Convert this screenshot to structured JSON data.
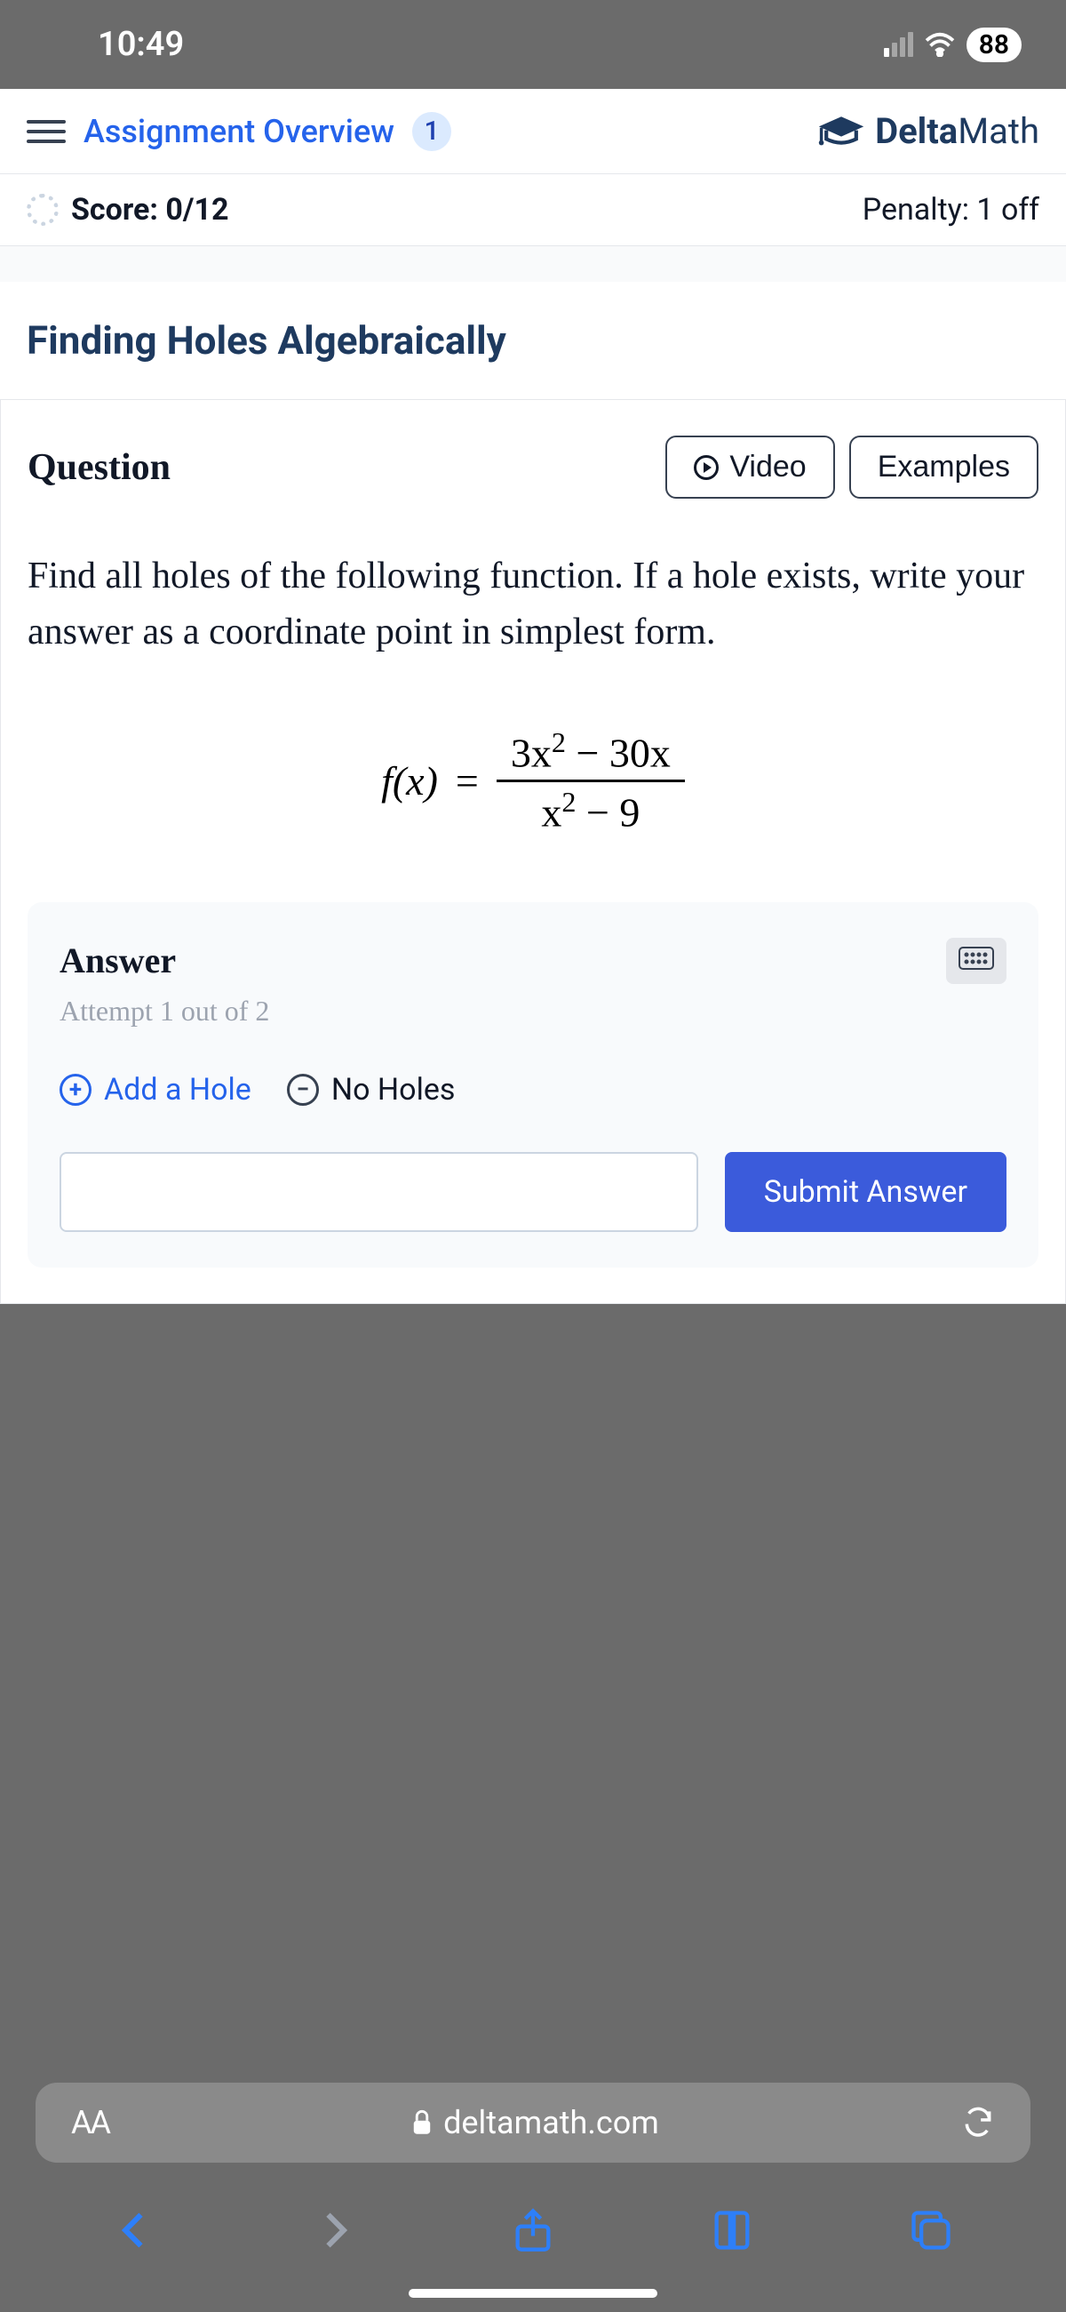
{
  "status": {
    "time": "10:49",
    "battery": "88"
  },
  "header": {
    "assignment": "Assignment Overview",
    "badge": "1",
    "brand_a": "Delta",
    "brand_b": "Math"
  },
  "scorebar": {
    "score_label": "Score: 0/12",
    "penalty_label": "Penalty:",
    "penalty_value": " 1 off"
  },
  "topic": "Finding Holes Algebraically",
  "question": {
    "heading": "Question",
    "video_btn": "Video",
    "examples_btn": "Examples",
    "prompt": "Find all holes of the following function. If a hole exists, write your answer as a coordinate point in simplest form."
  },
  "equation": {
    "lhs": "f(x)",
    "eq": "=",
    "num": "3x² − 30x",
    "den": "x² − 9"
  },
  "answer": {
    "title": "Answer",
    "attempt": "Attempt 1 out of 2",
    "add_hole": "Add a Hole",
    "no_holes": "No Holes",
    "submit": "Submit Answer"
  },
  "browser": {
    "aa": "AA",
    "domain": "deltamath.com"
  }
}
